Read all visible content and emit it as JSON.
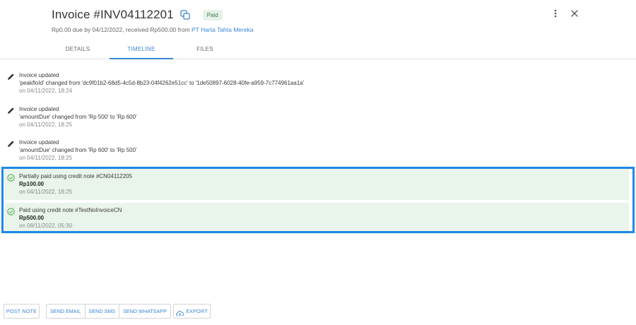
{
  "header": {
    "title": "Invoice #INV04112201",
    "status_badge": "Paid",
    "summary_prefix": "Rp0.00 due by 04/12/2022, received Rp500.00  from ",
    "customer_link": "PT Harta Tahta Mereka"
  },
  "tabs": [
    {
      "label": "DETAILS",
      "active": false
    },
    {
      "label": "TIMELINE",
      "active": true
    },
    {
      "label": "FILES",
      "active": false
    }
  ],
  "timeline": [
    {
      "icon": "pencil-icon",
      "title": "Invoice updated",
      "detail": "'peakfloId' changed from 'dc9f01b2-68d5-4c5d-8b23-04f4262e51cc' to '1de50897-6028-40fe-a959-7c774961aa1a'",
      "time": "on 04/11/2022, 18:24",
      "paid": false
    },
    {
      "icon": "pencil-icon",
      "title": "Invoice updated",
      "detail": "'amountDue' changed from 'Rp 500' to 'Rp 600'",
      "time": "on 04/11/2022, 18:25",
      "paid": false
    },
    {
      "icon": "pencil-icon",
      "title": "Invoice updated",
      "detail": "'amountDue' changed from 'Rp 600' to 'Rp 500'",
      "time": "on 04/11/2022, 18:25",
      "paid": false
    },
    {
      "icon": "check-circle-icon",
      "title": "Partially paid using credit note #CN04112205",
      "detail": "Rp100.00",
      "time": "on 04/11/2022, 18:25",
      "paid": true
    },
    {
      "icon": "check-circle-icon",
      "title": "Paid using credit note #TestNoInvoiceCN",
      "detail": "Rp500.00",
      "time": "on 08/11/2022, 05:30",
      "paid": true
    }
  ],
  "actions": {
    "post_note": "POST NOTE",
    "send_email": "SEND EMAIL",
    "send_sms": "SEND SMS",
    "send_whatsapp": "SEND WHATSAPP",
    "export": "EXPORT"
  },
  "colors": {
    "accent": "#3a86d4",
    "paid_bg": "#e9f4ea",
    "paid_icon": "#4caf50",
    "highlight": "#1e88e5"
  }
}
